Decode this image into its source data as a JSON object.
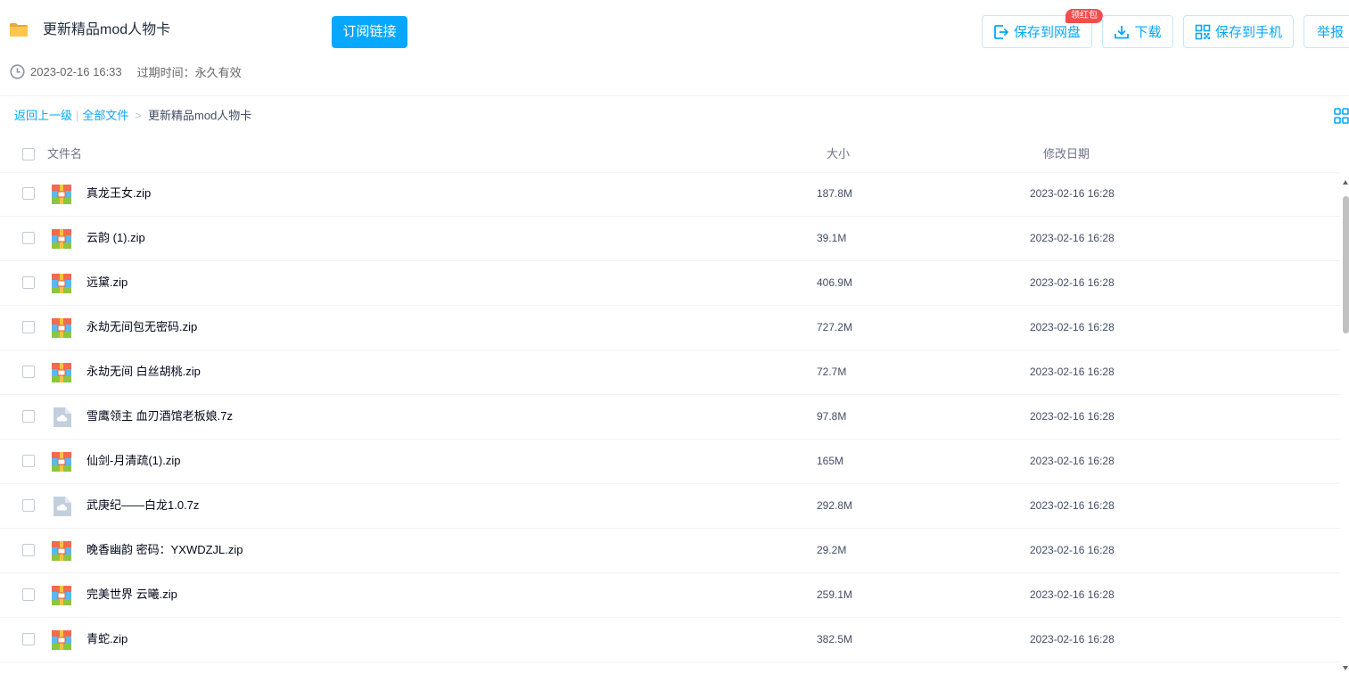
{
  "share": {
    "title": "更新精品mod人物卡",
    "subscribe_label": "订阅链接",
    "created": "2023-02-16 16:33",
    "expire_label": "过期时间：",
    "expire_value": "永久有效"
  },
  "actions": {
    "save_cloud": "保存到网盘",
    "badge": "领红包",
    "download": "下载",
    "save_phone": "保存到手机",
    "report": "举报"
  },
  "breadcrumb": {
    "back": "返回上一级",
    "sep": "|",
    "all_files": "全部文件",
    "gt": ">",
    "current": "更新精品mod人物卡"
  },
  "table": {
    "columns": {
      "name": "文件名",
      "size": "大小",
      "date": "修改日期"
    },
    "rows": [
      {
        "name": "真龙王女.zip",
        "size": "187.8M",
        "date": "2023-02-16 16:28",
        "icon": "zip-archive-icon"
      },
      {
        "name": "云韵 (1).zip",
        "size": "39.1M",
        "date": "2023-02-16 16:28",
        "icon": "zip-archive-icon"
      },
      {
        "name": "远黛.zip",
        "size": "406.9M",
        "date": "2023-02-16 16:28",
        "icon": "zip-archive-icon"
      },
      {
        "name": "永劫无间包无密码.zip",
        "size": "727.2M",
        "date": "2023-02-16 16:28",
        "icon": "zip-archive-icon"
      },
      {
        "name": "永劫无间 白丝胡桃.zip",
        "size": "72.7M",
        "date": "2023-02-16 16:28",
        "icon": "zip-archive-icon"
      },
      {
        "name": "雪鹰领主 血刃酒馆老板娘.7z",
        "size": "97.8M",
        "date": "2023-02-16 16:28",
        "icon": "unknown-file-icon"
      },
      {
        "name": "仙剑-月清疏(1).zip",
        "size": "165M",
        "date": "2023-02-16 16:28",
        "icon": "zip-archive-icon"
      },
      {
        "name": "武庚纪——白龙1.0.7z",
        "size": "292.8M",
        "date": "2023-02-16 16:28",
        "icon": "unknown-file-icon"
      },
      {
        "name": "晚香幽韵 密码：YXWDZJL.zip",
        "size": "29.2M",
        "date": "2023-02-16 16:28",
        "icon": "zip-archive-icon"
      },
      {
        "name": "完美世界 云曦.zip",
        "size": "259.1M",
        "date": "2023-02-16 16:28",
        "icon": "zip-archive-icon"
      },
      {
        "name": "青蛇.zip",
        "size": "382.5M",
        "date": "2023-02-16 16:28",
        "icon": "zip-archive-icon"
      }
    ]
  },
  "colors": {
    "accent": "#06a7ff",
    "badge": "#f44d4d",
    "text": "#424e67"
  }
}
